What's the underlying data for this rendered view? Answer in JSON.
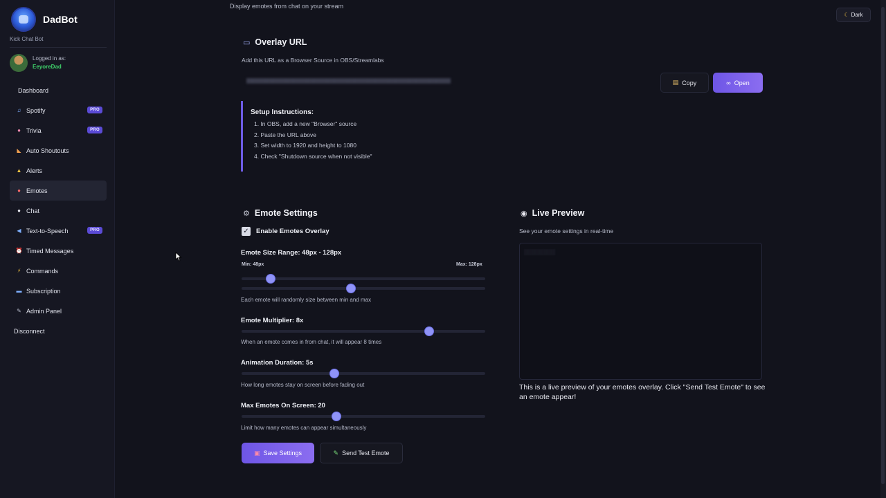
{
  "app": {
    "name": "DadBot",
    "tagline": "Kick Chat Bot"
  },
  "user": {
    "label": "Logged in as:",
    "name": "EeyoreDad"
  },
  "nav": {
    "items": [
      {
        "label": "Dashboard",
        "icon": "none",
        "pro": false
      },
      {
        "label": "Spotify",
        "icon": "music-note-icon",
        "pro": true
      },
      {
        "label": "Trivia",
        "icon": "brain-icon",
        "pro": true
      },
      {
        "label": "Auto Shoutouts",
        "icon": "megaphone-icon",
        "pro": false
      },
      {
        "label": "Alerts",
        "icon": "bell-icon",
        "pro": false
      },
      {
        "label": "Emotes",
        "icon": "smiley-icon",
        "pro": false,
        "active": true
      },
      {
        "label": "Chat",
        "icon": "chat-bubble-icon",
        "pro": false
      },
      {
        "label": "Text-to-Speech",
        "icon": "speaker-icon",
        "pro": true
      },
      {
        "label": "Timed Messages",
        "icon": "alarm-clock-icon",
        "pro": false
      },
      {
        "label": "Commands",
        "icon": "lightning-icon",
        "pro": false
      },
      {
        "label": "Subscription",
        "icon": "credit-card-icon",
        "pro": false
      },
      {
        "label": "Admin Panel",
        "icon": "wrench-icon",
        "pro": false
      },
      {
        "label": "Disconnect",
        "icon": "none",
        "pro": false
      }
    ],
    "pro_badge": "PRO"
  },
  "header": {
    "subtitle": "Display emotes from chat on your stream",
    "theme_label": "Dark"
  },
  "overlay": {
    "title": "Overlay URL",
    "description": "Add this URL as a Browser Source in OBS/Streamlabs",
    "copy_label": "Copy",
    "open_label": "Open"
  },
  "instructions": {
    "title": "Setup Instructions:",
    "steps": [
      "1. In OBS, add a new \"Browser\" source",
      "2. Paste the URL above",
      "3. Set width to 1920 and height to 1080",
      "4. Check \"Shutdown source when not visible\""
    ]
  },
  "settings": {
    "title": "Emote Settings",
    "enable_label": "Enable Emotes Overlay",
    "enabled": true,
    "size_range": {
      "label": "Emote Size Range: 48px - 128px",
      "min_label": "Min: 48px",
      "max_label": "Max: 128px",
      "min_value": 48,
      "max_value": 128,
      "min_fraction": 0.12,
      "max_fraction": 0.45,
      "help": "Each emote will randomly size between min and max"
    },
    "multiplier": {
      "label": "Emote Multiplier: 8x",
      "value": 8,
      "fraction": 0.77,
      "help": "When an emote comes in from chat, it will appear 8 times"
    },
    "duration": {
      "label": "Animation Duration: 5s",
      "value": 5,
      "fraction": 0.38,
      "help": "How long emotes stay on screen before fading out"
    },
    "max_emotes": {
      "label": "Max Emotes On Screen: 20",
      "value": 20,
      "fraction": 0.39,
      "help": "Limit how many emotes can appear simultaneously"
    },
    "save_label": "Save Settings",
    "test_label": "Send Test Emote"
  },
  "preview": {
    "title": "Live Preview",
    "description": "See your emote settings in real-time",
    "note": "This is a live preview of your emotes overlay. Click \"Send Test Emote\" to see an emote appear!"
  },
  "colors": {
    "accent": "#7b63ea",
    "background": "#12131c",
    "sidebar": "#161722",
    "online_green": "#3fd06a"
  }
}
